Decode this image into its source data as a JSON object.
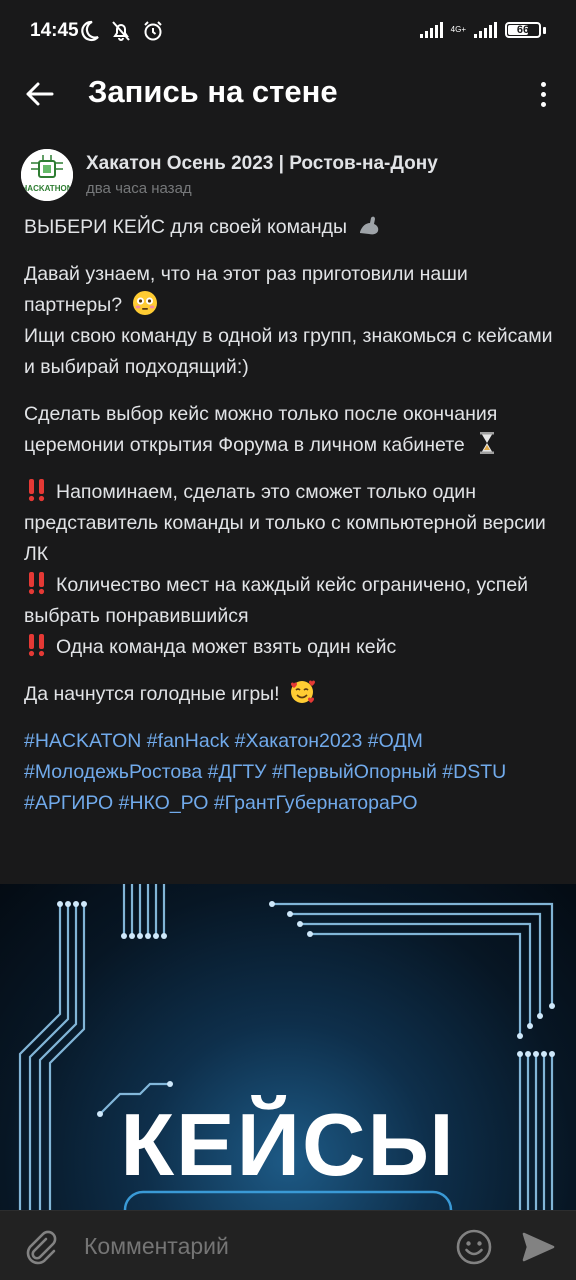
{
  "status_bar": {
    "time": "14:45",
    "network_label": "4G+",
    "battery": "66"
  },
  "app_bar": {
    "title": "Запись на стене"
  },
  "post": {
    "author": "Хакатон Осень 2023 | Ростов-на-Дону",
    "time": "два часа назад",
    "avatar_text": "HACKATHON",
    "paragraphs": [
      "ВЫБЕРИ КЕЙС для своей команды",
      "Давай узнаем, что на этот раз приготовили наши партнеры?",
      "Ищи свою команду в одной из групп, знакомься с кейсами и выбирай подходящий:)",
      "Сделать выбор кейс можно только после окончания церемонии открытия Форума в личном кабинете",
      "Напоминаем, сделать это сможет только один представитель команды и только с компьютерной версии ЛК",
      "Количество мест на каждый кейс ограничено, успей выбрать понравившийся",
      "Одна команда может взять один кейс",
      "Да начнутся голодные игры!"
    ],
    "hashtags": "#HACKATON #fanHack #Хакатон2023 #ОДМ #МолодежьРостова #ДГТУ #ПервыйОпорный #DSTU #АРГИРО #НКО_РО #ГрантГубернатораРО"
  },
  "banner": {
    "title": "КЕЙСЫ"
  },
  "comment_bar": {
    "placeholder": "Комментарий"
  },
  "colors": {
    "background": "#19191a",
    "text": "#e1e3e6",
    "secondary_text": "#76787a",
    "link": "#71aaeb",
    "banner_blue": "#1d5a86"
  }
}
